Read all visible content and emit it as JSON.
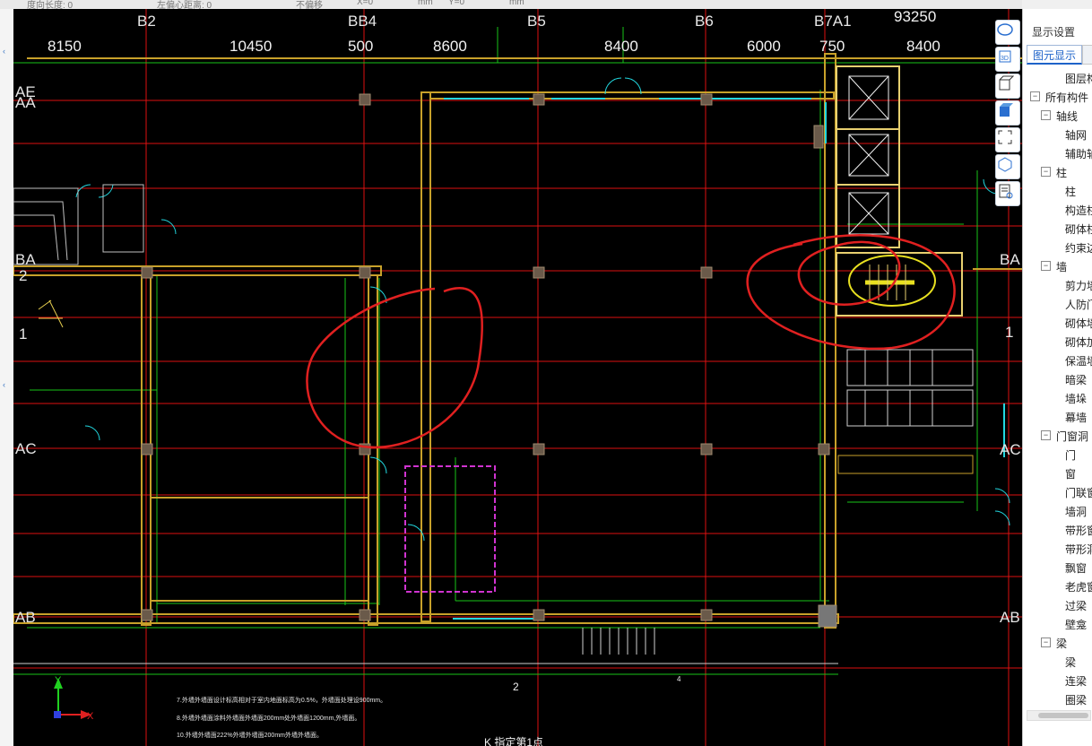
{
  "toolbar": {
    "field1_label": "度向长度: 0",
    "field2_label": "左偏心距离: 0",
    "field3_label": "不偏移",
    "x_label": "X=0",
    "unit1": "mm",
    "y_label": "Y=0",
    "unit2": "mm"
  },
  "axes_top": [
    "B2",
    "BB4",
    "B5",
    "B6",
    "B7A1"
  ],
  "axes_left": [
    "AE",
    "AA",
    "BA",
    "2",
    "1",
    "AC",
    "AB"
  ],
  "axes_right": [
    "BA",
    "1",
    "AC",
    "AB"
  ],
  "top_dims": [
    "8150",
    "10450",
    "500",
    "8600",
    "8400",
    "6000",
    "750",
    "8400"
  ],
  "total_dim": "93250",
  "cad_notes": {
    "bottom_axis": "2",
    "note_right": "4",
    "notes_bottom": [
      "7.外墙外墙面设计标高相对于室内地面标高为0.5%，外墙面处理设900mm。",
      "8.外墙外墙面涂料外墙面外墙面200mm处外墙面1200mm,外墙面。",
      "10.外墙外墙面222%外墙外墙面200mm外墙外墙面。"
    ],
    "bottom_caption": "K 指定第1点"
  },
  "view_tools": [
    "orbit-view-icon",
    "3d-view-icon",
    "box-view-icon",
    "cube-view-icon",
    "fit-view-icon",
    "perspective-view-icon",
    "properties-icon"
  ],
  "panel": {
    "title": "显示设置",
    "tab_active": "图元显示",
    "tree": [
      {
        "label": "图层构件",
        "level": 0,
        "toggle": ""
      },
      {
        "label": "所有构件",
        "level": 0,
        "toggle": "−"
      },
      {
        "label": "轴线",
        "level": 1,
        "toggle": "−"
      },
      {
        "label": "轴网",
        "level": 2,
        "toggle": ""
      },
      {
        "label": "辅助轴线",
        "level": 2,
        "toggle": ""
      },
      {
        "label": "柱",
        "level": 1,
        "toggle": "−"
      },
      {
        "label": "柱",
        "level": 2,
        "toggle": ""
      },
      {
        "label": "构造柱",
        "level": 2,
        "toggle": ""
      },
      {
        "label": "砌体柱",
        "level": 2,
        "toggle": ""
      },
      {
        "label": "约束边缘",
        "level": 2,
        "toggle": ""
      },
      {
        "label": "墙",
        "level": 1,
        "toggle": "−"
      },
      {
        "label": "剪力墙",
        "level": 2,
        "toggle": ""
      },
      {
        "label": "人防门框墙",
        "level": 2,
        "toggle": ""
      },
      {
        "label": "砌体墙",
        "level": 2,
        "toggle": ""
      },
      {
        "label": "砌体加筋",
        "level": 2,
        "toggle": ""
      },
      {
        "label": "保温墙",
        "level": 2,
        "toggle": ""
      },
      {
        "label": "暗梁",
        "level": 2,
        "toggle": ""
      },
      {
        "label": "墙垛",
        "level": 2,
        "toggle": ""
      },
      {
        "label": "幕墙",
        "level": 2,
        "toggle": ""
      },
      {
        "label": "门窗洞",
        "level": 1,
        "toggle": "−"
      },
      {
        "label": "门",
        "level": 2,
        "toggle": ""
      },
      {
        "label": "窗",
        "level": 2,
        "toggle": ""
      },
      {
        "label": "门联窗",
        "level": 2,
        "toggle": ""
      },
      {
        "label": "墙洞",
        "level": 2,
        "toggle": ""
      },
      {
        "label": "带形窗",
        "level": 2,
        "toggle": ""
      },
      {
        "label": "带形洞",
        "level": 2,
        "toggle": ""
      },
      {
        "label": "飘窗",
        "level": 2,
        "toggle": ""
      },
      {
        "label": "老虎窗",
        "level": 2,
        "toggle": ""
      },
      {
        "label": "过梁",
        "level": 2,
        "toggle": ""
      },
      {
        "label": "壁龛",
        "level": 2,
        "toggle": ""
      },
      {
        "label": "梁",
        "level": 1,
        "toggle": "−"
      },
      {
        "label": "梁",
        "level": 2,
        "toggle": ""
      },
      {
        "label": "连梁",
        "level": 2,
        "toggle": ""
      },
      {
        "label": "圈梁",
        "level": 2,
        "toggle": ""
      }
    ]
  },
  "ucs": {
    "x_label": "X",
    "y_label": "Y"
  }
}
